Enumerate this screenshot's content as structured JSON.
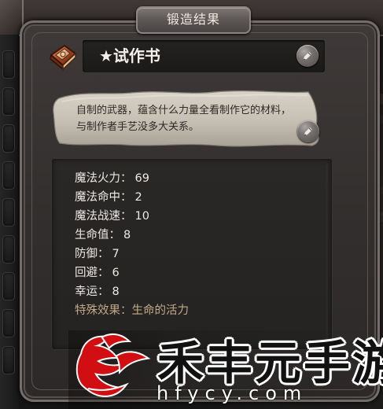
{
  "dialog": {
    "title": "锻造结果",
    "item_name": "★试作书",
    "description": "自制的武器，蕴含什么力量全看制作它的材料，与制作者手艺没多大关系。"
  },
  "stats": [
    {
      "label": "魔法火力：",
      "value": "69"
    },
    {
      "label": "魔法命中：",
      "value": "2"
    },
    {
      "label": "魔法战速：",
      "value": "10"
    },
    {
      "label": "生命值：",
      "value": "8"
    },
    {
      "label": "防御：",
      "value": "7"
    },
    {
      "label": "回避：",
      "value": "6"
    },
    {
      "label": "幸运：",
      "value": "8"
    }
  ],
  "special_effect": {
    "label": "特殊效果：",
    "value": "生命的活力"
  },
  "watermark": {
    "title": "禾丰元手游",
    "url": "hfycy.com"
  },
  "icons": {
    "item": "book-icon",
    "edit": "pencil-icon",
    "logo": "brand-logo-icon"
  },
  "colors": {
    "panel": "#312e2d",
    "title_text": "#f0e8df",
    "stat_text": "#ece8e3",
    "special_text": "#c2aa88",
    "paper": "#c8c2b7",
    "watermark_red": "#d10f12"
  }
}
